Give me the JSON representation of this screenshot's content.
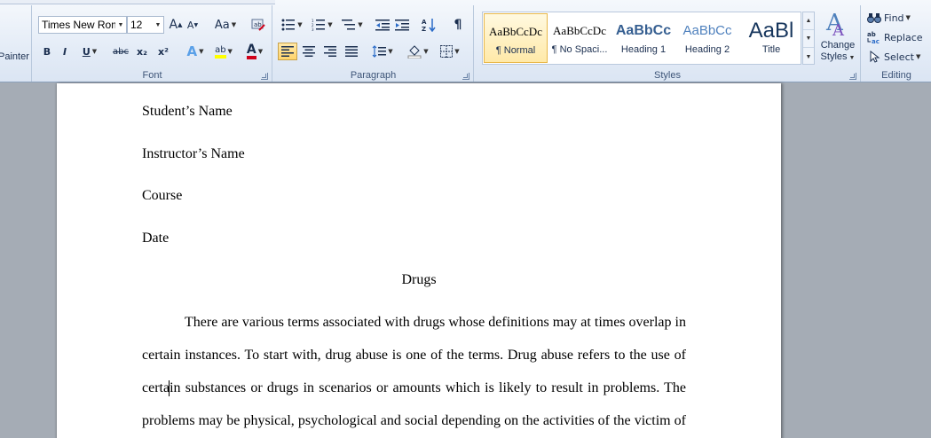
{
  "clipboard": {
    "painter_label": "Painter"
  },
  "font": {
    "font_name": "Times New Rom",
    "font_size": "12",
    "label": "Font",
    "grow": "A",
    "shrink": "A",
    "change_case": "Aa",
    "bold": "B",
    "italic": "I",
    "underline": "U",
    "strikethrough": "abc",
    "subscript": "x₂",
    "superscript": "x²",
    "text_effects": "A",
    "highlight": "ab",
    "font_color": "A",
    "accent_red": "#d0021b",
    "highlight_yellow": "#ffff00"
  },
  "paragraph": {
    "label": "Paragraph",
    "pilcrow": "¶"
  },
  "styles": {
    "label": "Styles",
    "items": [
      {
        "sample": "AaBbCcDc",
        "name": "¶ Normal"
      },
      {
        "sample": "AaBbCcDc",
        "name": "¶ No Spaci..."
      },
      {
        "sample": "AaBbCc",
        "name": "Heading 1"
      },
      {
        "sample": "AaBbCc",
        "name": "Heading 2"
      },
      {
        "sample": "AaBl",
        "name": "Title"
      }
    ],
    "change_styles_line1": "Change",
    "change_styles_line2": "Styles"
  },
  "editing": {
    "label": "Editing",
    "find": "Find",
    "replace": "Replace",
    "select": "Select"
  },
  "document": {
    "student_name": "Student’s Name",
    "instructor_name": "Instructor’s Name",
    "course": "Course",
    "date": "Date",
    "title": "Drugs",
    "body_lines": [
      "There are various terms associated with drugs whose definitions may at times overlap in",
      "certain instances. To start with, drug abuse is one of the terms. Drug abuse refers to the use of",
      "certain substances or drugs in scenarios or amounts which is likely to result in problems. The",
      "problems may be physical, psychological and social depending on the activities of the victim of"
    ]
  }
}
